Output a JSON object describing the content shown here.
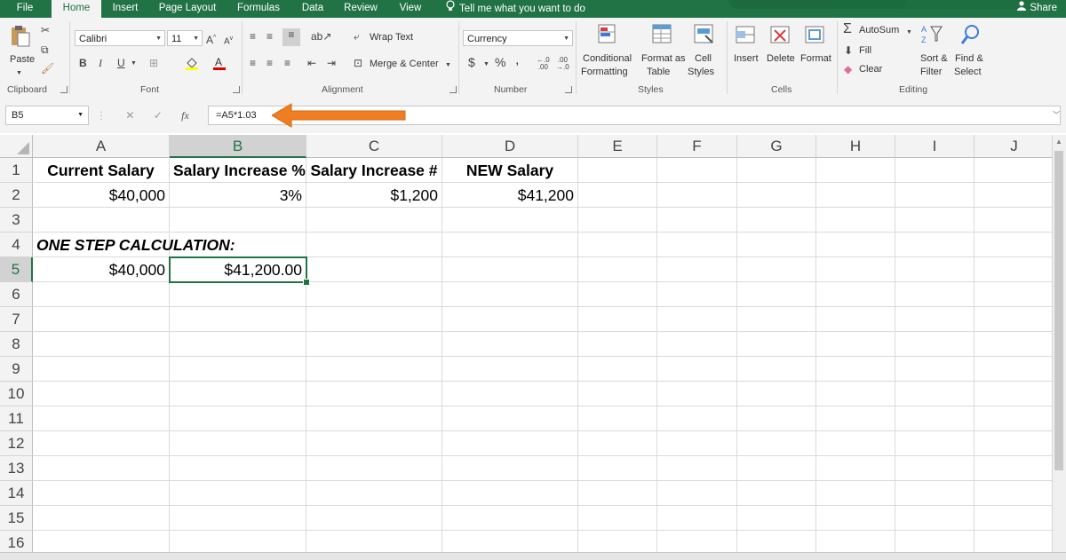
{
  "tabs": [
    "File",
    "Home",
    "Insert",
    "Page Layout",
    "Formulas",
    "Data",
    "Review",
    "View"
  ],
  "active_tab": "Home",
  "tell_me": "Tell me what you want to do",
  "share_label": "Share",
  "ribbon": {
    "clipboard": {
      "paste": "Paste",
      "label": "Clipboard"
    },
    "font": {
      "name": "Calibri",
      "size": "11",
      "bold": "B",
      "italic": "I",
      "underline": "U",
      "label": "Font"
    },
    "alignment": {
      "wrap_text": "Wrap Text",
      "merge_center": "Merge & Center",
      "label": "Alignment"
    },
    "number": {
      "format": "Currency",
      "dollar": "$",
      "percent": "%",
      "comma": ",",
      "label": "Number"
    },
    "styles": {
      "conditional": "Conditional",
      "conditional2": "Formatting",
      "format_as": "Format as",
      "format_as2": "Table",
      "cell": "Cell",
      "cell2": "Styles",
      "label": "Styles"
    },
    "cells": {
      "insert": "Insert",
      "delete": "Delete",
      "format": "Format",
      "label": "Cells"
    },
    "editing": {
      "autosum": "AutoSum",
      "fill": "Fill",
      "clear": "Clear",
      "sort": "Sort &",
      "sort2": "Filter",
      "find": "Find &",
      "find2": "Select",
      "label": "Editing"
    }
  },
  "formula_bar": {
    "name_box": "B5",
    "formula": "=A5*1.03",
    "fx": "fx"
  },
  "columns": [
    "A",
    "B",
    "C",
    "D",
    "E",
    "F",
    "G",
    "H",
    "I",
    "J"
  ],
  "selected_column": "B",
  "rows": [
    "1",
    "2",
    "3",
    "4",
    "5",
    "6",
    "7",
    "8",
    "9",
    "10",
    "11",
    "12",
    "13",
    "14",
    "15",
    "16"
  ],
  "selected_row": "5",
  "cells": {
    "A1": "Current Salary",
    "B1": "Salary Increase %",
    "C1": "Salary Increase #",
    "D1": "NEW Salary",
    "A2": "$40,000",
    "B2": "3%",
    "C2": "$1,200",
    "D2": "$41,200",
    "A4": "ONE STEP CALCULATION:",
    "A5": "$40,000",
    "B5": "$41,200.00"
  },
  "colors": {
    "excel_green": "#217346",
    "arrow_orange": "#ef7d22"
  }
}
